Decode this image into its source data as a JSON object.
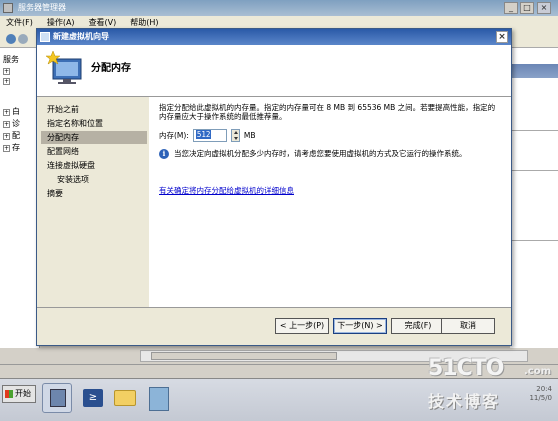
{
  "main_window": {
    "title": "服务器管理器",
    "controls": {
      "minimize": "_",
      "maximize": "□",
      "close": "×"
    },
    "menu": [
      "文件(F)",
      "操作(A)",
      "查看(V)",
      "帮助(H)"
    ],
    "tree_labels": [
      "服务",
      "⊞",
      "⊞",
      "⊞",
      "⊞",
      "⊞",
      "⊞"
    ],
    "tree_partial": [
      "服务",
      "白",
      "诊",
      "配",
      "存"
    ]
  },
  "wizard": {
    "title": "新建虚拟机向导",
    "close_glyph": "×",
    "header_title": "分配内存",
    "steps": [
      {
        "label": "开始之前",
        "active": false,
        "sub": false
      },
      {
        "label": "指定名称和位置",
        "active": false,
        "sub": false
      },
      {
        "label": "分配内存",
        "active": true,
        "sub": false
      },
      {
        "label": "配置网络",
        "active": false,
        "sub": false
      },
      {
        "label": "连接虚拟硬盘",
        "active": false,
        "sub": false
      },
      {
        "label": "安装选项",
        "active": false,
        "sub": true
      },
      {
        "label": "摘要",
        "active": false,
        "sub": false
      }
    ],
    "description": "指定分配给此虚拟机的内存量。指定的内存量可在 8 MB 到 65536 MB 之间。若要提高性能，指定的内存量应大于操作系统的最低推荐量。",
    "memory_label": "内存(M):",
    "memory_value": "512",
    "memory_unit": "MB",
    "info_text": "当您决定向虚拟机分配多少内存时，请考虑您要使用虚拟机的方式及它运行的操作系统。",
    "info_icon": "i",
    "details_link": "有关确定将内存分配给虚拟机的详细信息",
    "buttons": {
      "prev": "< 上一步(P)",
      "next": "下一步(N) >",
      "finish": "完成(F)",
      "cancel": "取消"
    }
  },
  "taskbar": {
    "start_label": "开始",
    "powershell_glyph": "≥",
    "clock_time": "20:4",
    "clock_date": "11/5/0"
  },
  "watermark": {
    "logo": "51CTO",
    "tld": ".com",
    "sub": "技术博客"
  }
}
